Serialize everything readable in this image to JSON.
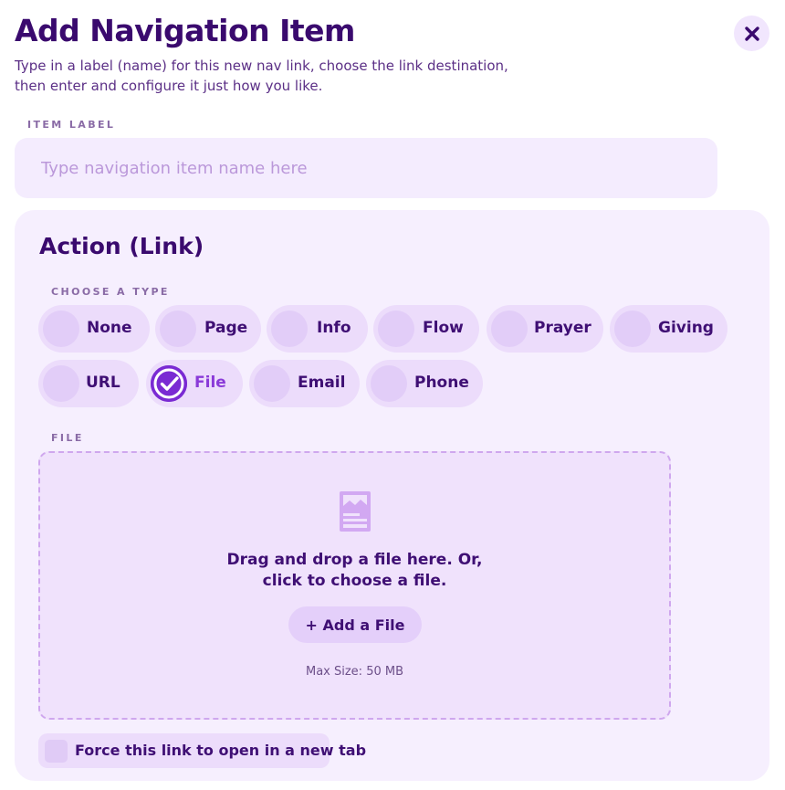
{
  "modal": {
    "title": "Add Navigation Item",
    "subtitle_line1": "Type in a label (name) for this new nav link, choose the link destination,",
    "subtitle_line2": "then enter and configure it just how you like."
  },
  "item_label": {
    "caption": "ITEM LABEL",
    "placeholder": "Type navigation item name here",
    "value": ""
  },
  "action": {
    "title": "Action (Link)",
    "choose_caption": "CHOOSE A TYPE",
    "types": [
      {
        "label": "None",
        "selected": false
      },
      {
        "label": "Page",
        "selected": false
      },
      {
        "label": "Info",
        "selected": false
      },
      {
        "label": "Flow",
        "selected": false
      },
      {
        "label": "Prayer",
        "selected": false
      },
      {
        "label": "Giving",
        "selected": false
      },
      {
        "label": "URL",
        "selected": false
      },
      {
        "label": "File",
        "selected": true
      },
      {
        "label": "Email",
        "selected": false
      },
      {
        "label": "Phone",
        "selected": false
      }
    ]
  },
  "file": {
    "caption": "FILE",
    "drop_line1": "Drag and drop a file here. Or,",
    "drop_line2": "click to choose a file.",
    "add_button": "+ Add a File",
    "max_size": "Max Size: 50 MB",
    "icon": "document-image-icon"
  },
  "force_new_tab": {
    "label": "Force this link to open in a new tab",
    "checked": false
  },
  "colors": {
    "title": "#3a0a6e",
    "accent": "#7a2ad3",
    "chip_bg": "#ecdcfb",
    "card_bg": "#f6effe"
  }
}
